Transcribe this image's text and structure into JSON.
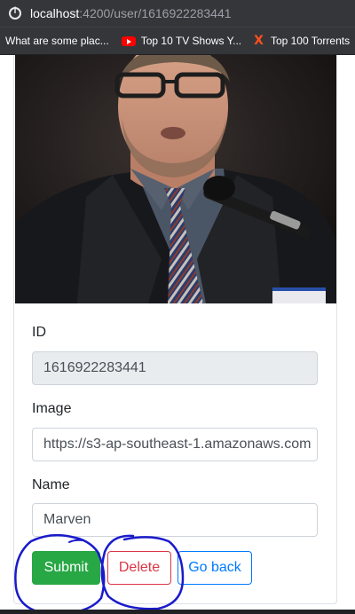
{
  "browser": {
    "url_host": "localhost",
    "url_path": ":4200/user/1616922283441",
    "bookmarks": [
      {
        "label": "What are some plac...",
        "icon": "document-icon"
      },
      {
        "label": "Top 10 TV Shows Y...",
        "icon": "youtube-icon"
      },
      {
        "label": "Top 100 Torrents",
        "icon": "x-logo-icon"
      }
    ]
  },
  "form": {
    "id_label": "ID",
    "id_value": "1616922283441",
    "image_label": "Image",
    "image_value": "https://s3-ap-southeast-1.amazonaws.com",
    "name_label": "Name",
    "name_value": "Marven"
  },
  "buttons": {
    "submit": "Submit",
    "delete": "Delete",
    "go_back": "Go back"
  },
  "colors": {
    "success": "#28a745",
    "danger": "#dc3545",
    "primary": "#007bff",
    "annotation_ink": "#1a1acc"
  }
}
